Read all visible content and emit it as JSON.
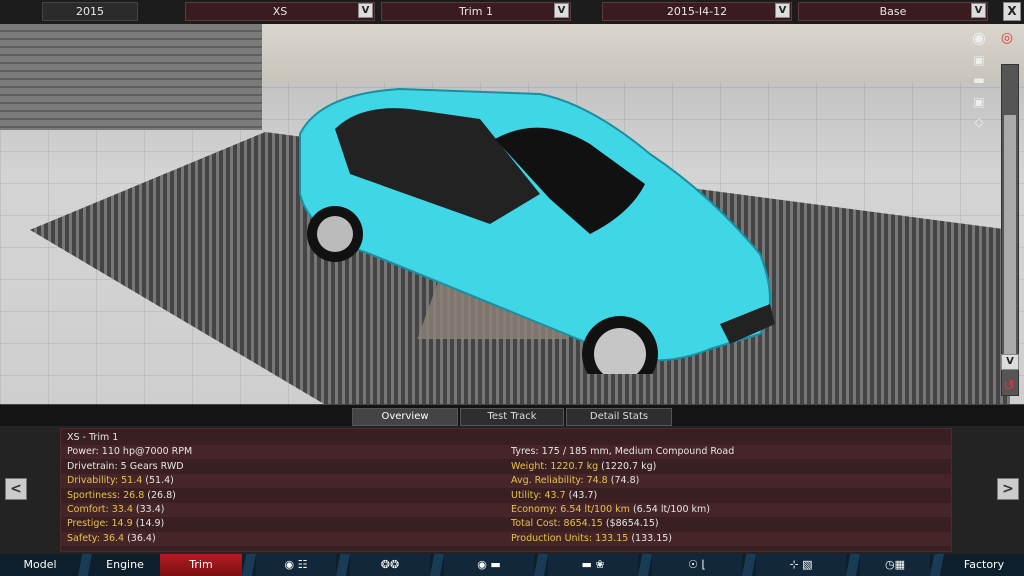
{
  "topbar": {
    "year": "2015",
    "model": "XS",
    "trim": "Trim 1",
    "engine": "2015-I4-12",
    "variant": "Base",
    "dropdown_glyph": "V",
    "close_glyph": "X"
  },
  "viewport": {
    "car_color": "#3fd6e6",
    "icons": [
      "camera-icon",
      "eye-icon",
      "car-front-icon",
      "car-side-icon",
      "car-rear-icon",
      "car-top-icon"
    ]
  },
  "scroll": {
    "down_glyph": "V"
  },
  "tabs": [
    {
      "label": "Overview",
      "active": true
    },
    {
      "label": "Test Track",
      "active": false
    },
    {
      "label": "Detail Stats",
      "active": false
    }
  ],
  "stats": {
    "left": [
      {
        "label": "XS - Trim 1",
        "value": "",
        "highlight": false
      },
      {
        "label": "Power: ",
        "value": "110 hp@7000 RPM",
        "highlight": false
      },
      {
        "label": "Drivetrain: ",
        "value": "5 Gears RWD",
        "highlight": false
      },
      {
        "label": "Drivability: 51.4",
        "value": " (51.4)",
        "highlight": true
      },
      {
        "label": "Sportiness: 26.8",
        "value": " (26.8)",
        "highlight": true
      },
      {
        "label": "Comfort: 33.4",
        "value": " (33.4)",
        "highlight": true
      },
      {
        "label": "Prestige: 14.9",
        "value": " (14.9)",
        "highlight": true
      },
      {
        "label": "Safety: 36.4",
        "value": " (36.4)",
        "highlight": true
      }
    ],
    "right": [
      {
        "label": "",
        "value": "",
        "highlight": false
      },
      {
        "label": "Tyres: ",
        "value": "175 / 185 mm, Medium Compound Road",
        "highlight": false
      },
      {
        "label": "Weight: 1220.7 kg",
        "value": " (1220.7 kg)",
        "highlight": true
      },
      {
        "label": "Avg. Reliability: 74.8",
        "value": " (74.8)",
        "highlight": true
      },
      {
        "label": "Utility: 43.7",
        "value": " (43.7)",
        "highlight": true
      },
      {
        "label": "Economy: 6.54 lt/100 km",
        "value": " (6.54 lt/100 km)",
        "highlight": true
      },
      {
        "label": "Total Cost: 8654.15",
        "value": " ($8654.15)",
        "highlight": true
      },
      {
        "label": "Production Units: 133.15",
        "value": " (133.15)",
        "highlight": true
      }
    ]
  },
  "arrows": {
    "left": "<",
    "right": ">"
  },
  "bottomnav": {
    "model": "Model",
    "engine": "Engine",
    "trim": "Trim",
    "factory": "Factory"
  }
}
